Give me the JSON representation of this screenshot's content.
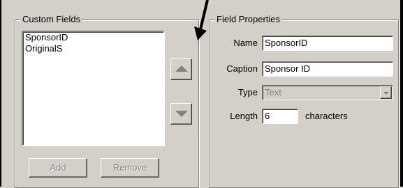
{
  "custom_fields": {
    "title": "Custom Fields",
    "items": [
      "SponsorID",
      "OriginalS"
    ],
    "add_label": "Add",
    "remove_label": "Remove"
  },
  "field_properties": {
    "title": "Field Properties",
    "name_label": "Name",
    "name_value": "SponsorID",
    "caption_label": "Caption",
    "caption_value": "Sponsor ID",
    "type_label": "Type",
    "type_value": "Text",
    "length_label": "Length",
    "length_value": "6",
    "length_unit": "characters"
  },
  "icons": {
    "move_up": "triangle-up-icon",
    "move_down": "triangle-down-icon",
    "dropdown": "chevron-down-icon",
    "pointer": "arrow-pointer-icon"
  }
}
